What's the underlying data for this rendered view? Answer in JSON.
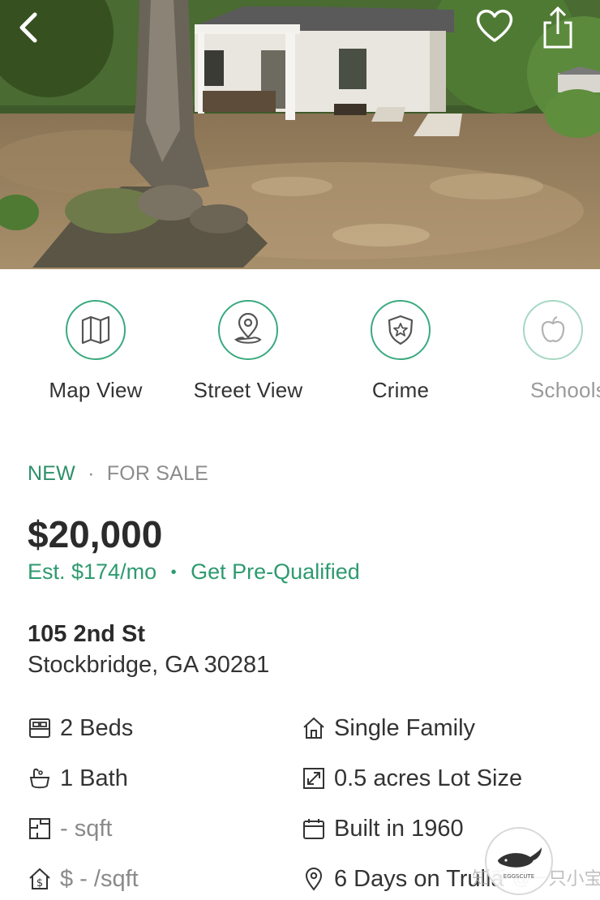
{
  "header": {
    "back_icon": "chevron-left-icon",
    "favorite_icon": "heart-icon",
    "share_icon": "share-icon"
  },
  "actions": [
    {
      "label": "Map View",
      "icon": "map-icon"
    },
    {
      "label": "Street View",
      "icon": "location-pin-icon"
    },
    {
      "label": "Crime",
      "icon": "shield-star-icon"
    },
    {
      "label": "Schools",
      "icon": "apple-icon"
    }
  ],
  "listing": {
    "status_new": "NEW",
    "status_separator": "·",
    "status_sale": "FOR SALE",
    "price": "$20,000",
    "estimate": "Est. $174/mo",
    "estimate_separator": "•",
    "prequalify_link": "Get Pre-Qualified",
    "street": "105 2nd St",
    "city": "Stockbridge, GA 30281"
  },
  "facts": {
    "beds": "2 Beds",
    "baths": "1 Bath",
    "sqft": "- sqft",
    "price_per_sqft": "$ - /sqft",
    "home_type": "Single Family",
    "lot_size": "0.5 acres Lot Size",
    "year_built": "Built in 1960",
    "days_on_market": "6 Days on Trulia"
  },
  "watermark": {
    "badge_text": "EGGSCUTE",
    "overlay_text": "知乎 @一只小宝"
  },
  "colors": {
    "accent_green": "#2e9a6f",
    "circle_border": "#3aaa7f"
  }
}
